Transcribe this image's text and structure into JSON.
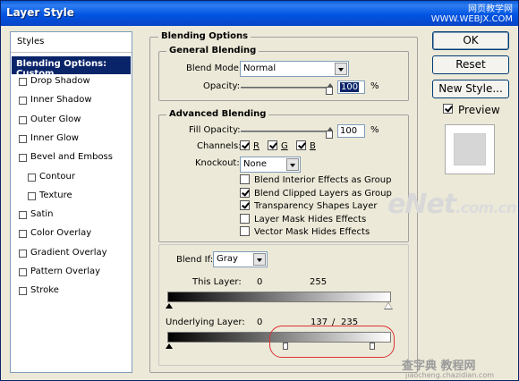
{
  "window": {
    "title": "Layer Style",
    "watermark_line1": "网页教学网",
    "watermark_line2": "WWW.WEBJX.COM"
  },
  "sidebar": {
    "styles_label": "Styles",
    "active_label": "Blending Options: Custom",
    "items": [
      {
        "label": "Drop Shadow",
        "checked": false,
        "indent": false
      },
      {
        "label": "Inner Shadow",
        "checked": false,
        "indent": false
      },
      {
        "label": "Outer Glow",
        "checked": false,
        "indent": false
      },
      {
        "label": "Inner Glow",
        "checked": false,
        "indent": false
      },
      {
        "label": "Bevel and Emboss",
        "checked": false,
        "indent": false
      },
      {
        "label": "Contour",
        "checked": false,
        "indent": true
      },
      {
        "label": "Texture",
        "checked": false,
        "indent": true
      },
      {
        "label": "Satin",
        "checked": false,
        "indent": false
      },
      {
        "label": "Color Overlay",
        "checked": false,
        "indent": false
      },
      {
        "label": "Gradient Overlay",
        "checked": false,
        "indent": false
      },
      {
        "label": "Pattern Overlay",
        "checked": false,
        "indent": false
      },
      {
        "label": "Stroke",
        "checked": false,
        "indent": false
      }
    ]
  },
  "blending": {
    "section_title": "Blending Options",
    "general": {
      "title": "General Blending",
      "blend_mode_label": "Blend Mode:",
      "blend_mode_value": "Normal",
      "opacity_label": "Opacity:",
      "opacity_value": "100",
      "opacity_unit": "%"
    },
    "advanced": {
      "title": "Advanced Blending",
      "fill_opacity_label": "Fill Opacity:",
      "fill_opacity_value": "100",
      "fill_opacity_unit": "%",
      "channels_label": "Channels:",
      "channels": [
        {
          "label": "R",
          "checked": true
        },
        {
          "label": "G",
          "checked": true
        },
        {
          "label": "B",
          "checked": true
        }
      ],
      "knockout_label": "Knockout:",
      "knockout_value": "None",
      "options": [
        {
          "label": "Blend Interior Effects as Group",
          "checked": false
        },
        {
          "label": "Blend Clipped Layers as Group",
          "checked": true
        },
        {
          "label": "Transparency Shapes Layer",
          "checked": true
        },
        {
          "label": "Layer Mask Hides Effects",
          "checked": false
        },
        {
          "label": "Vector Mask Hides Effects",
          "checked": false
        }
      ]
    },
    "blend_if": {
      "label": "Blend If:",
      "value": "Gray",
      "this_layer_label": "This Layer:",
      "this_layer_low": "0",
      "this_layer_high": "255",
      "underlying_label": "Underlying Layer:",
      "underlying_low": "0",
      "underlying_mid": "137",
      "underlying_sep": "/",
      "underlying_high": "235"
    }
  },
  "buttons": {
    "ok": "OK",
    "reset": "Reset",
    "new_style": "New Style...",
    "preview_label": "Preview",
    "preview_checked": true
  },
  "watermarks": {
    "enet_main": "eNet",
    "enet_domain": ".com.cn",
    "footer_cn": "查字典 教程网",
    "footer_en": "jiaocheng.chazidian.com"
  }
}
